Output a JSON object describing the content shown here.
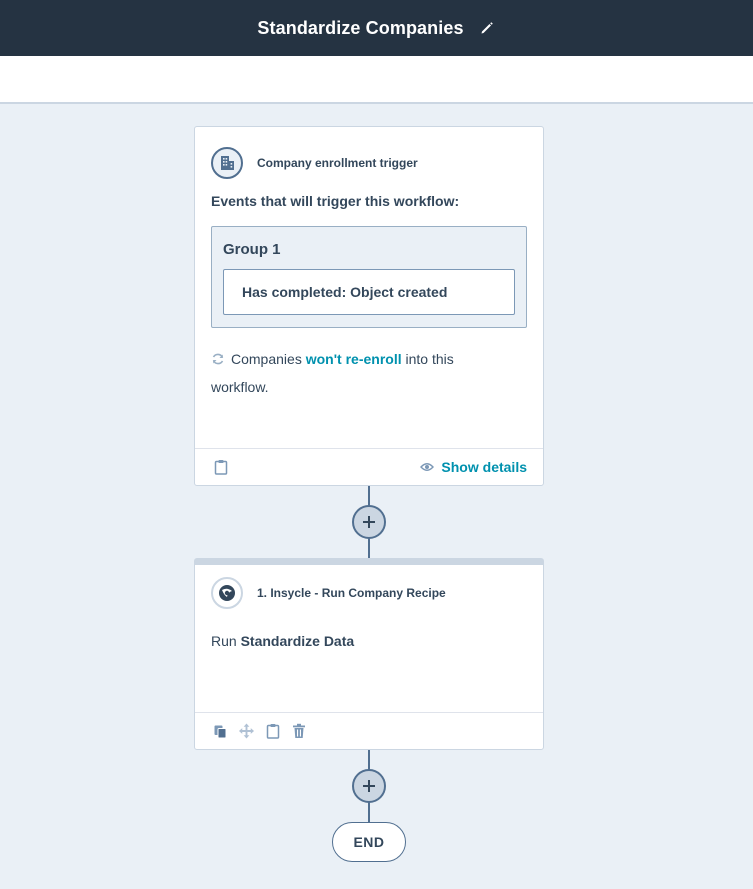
{
  "header": {
    "title": "Standardize Companies",
    "edit_icon": "pencil-icon"
  },
  "trigger_card": {
    "icon": "building-icon",
    "title": "Company enrollment trigger",
    "events_label": "Events that will trigger this workflow:",
    "group": {
      "title": "Group 1",
      "filter": "Has completed: Object created"
    },
    "reenroll": {
      "icon": "refresh-icon",
      "prefix": "Companies",
      "link": "won't re-enroll",
      "suffix_line1": "into this",
      "suffix_line2": "workflow."
    },
    "footer": {
      "clipboard_icon": "clipboard-icon",
      "show_details_icon": "eye-icon",
      "show_details": "Show details"
    }
  },
  "action_card": {
    "icon": "insycle-logo-icon",
    "title": "1. Insycle - Run Company Recipe",
    "body_prefix": "Run",
    "body_bold": "Standardize Data",
    "footer_icons": [
      "copy-icon",
      "move-icon",
      "clipboard-icon",
      "trash-icon"
    ]
  },
  "end_label": "END",
  "colors": {
    "header_bg": "#253342",
    "canvas_bg": "#eaf0f6",
    "link": "#0091ae",
    "text": "#33475b",
    "connector": "#516f90"
  }
}
